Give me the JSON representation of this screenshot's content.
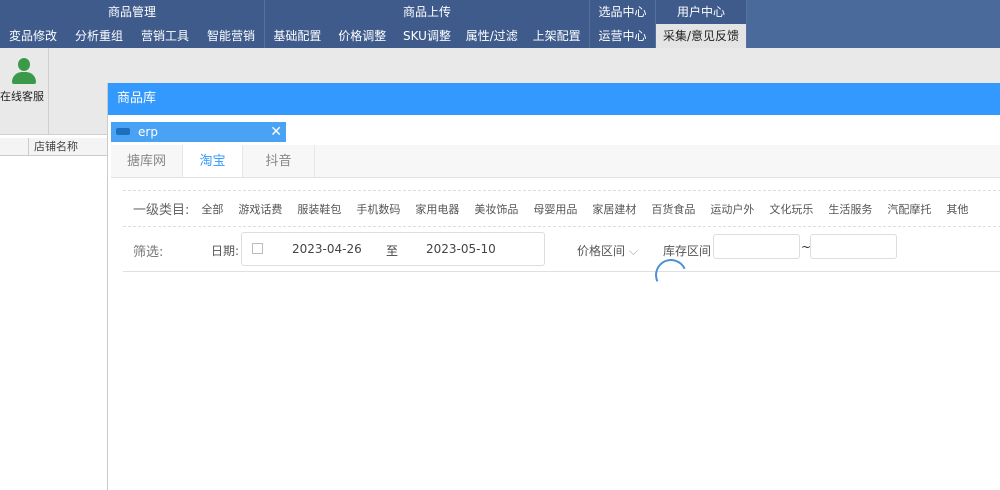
{
  "nav": {
    "groups": [
      {
        "title": "商品管理",
        "items": [
          "変品修改",
          "分析重组",
          "营销工具",
          "智能营销"
        ]
      },
      {
        "title": "商品上传",
        "items": [
          "基础配置",
          "价格调整",
          "SKU调整",
          "属性/过滤",
          "上架配置"
        ]
      },
      {
        "title": "选品中心",
        "items": [
          "运营中心"
        ]
      },
      {
        "title": "用户中心",
        "items": [
          "采集/意见反馈"
        ]
      }
    ]
  },
  "toolbar": {
    "customer_service": "在线客服"
  },
  "left_panel": {
    "col_shop_name": "店铺名称"
  },
  "dialog": {
    "title": "商品库",
    "doc_tab": "erp",
    "close": "✕",
    "tabs": [
      "搪库网",
      "淘宝",
      "抖音"
    ],
    "active_tab": "淘宝",
    "category_label": "一级类目:",
    "categories": [
      "全部",
      "游戏话费",
      "服装鞋包",
      "手机数码",
      "家用电器",
      "美妆饰品",
      "母婴用品",
      "家居建材",
      "百货食品",
      "运动户外",
      "文化玩乐",
      "生活服务",
      "汽配摩托",
      "其他"
    ],
    "filter_label": "筛选:",
    "date_label": "日期:",
    "date_start": "2023-04-26",
    "date_sep": "至",
    "date_end": "2023-05-10",
    "price_range": "价格区间",
    "stock_range": "库存区间",
    "stock_sep": "~"
  }
}
